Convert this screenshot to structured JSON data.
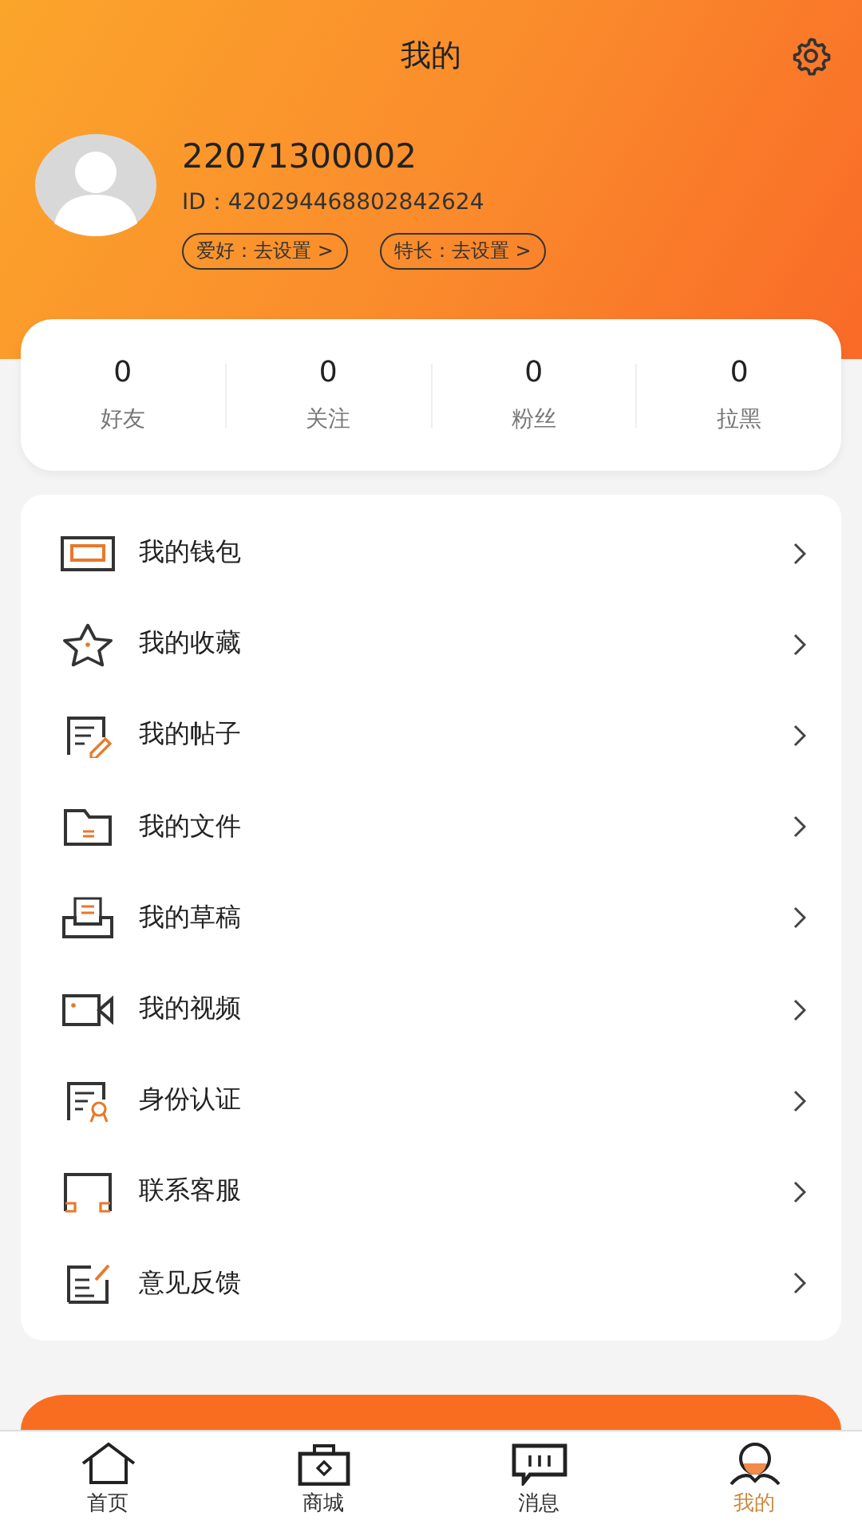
{
  "header": {
    "title": "我的"
  },
  "profile": {
    "name": "22071300002",
    "id": "ID：420294468802842624",
    "tags": [
      "爱好：去设置 >",
      "特长：去设置 >"
    ]
  },
  "stats": [
    {
      "value": "0",
      "label": "好友"
    },
    {
      "value": "0",
      "label": "关注"
    },
    {
      "value": "0",
      "label": "粉丝"
    },
    {
      "value": "0",
      "label": "拉黑"
    }
  ],
  "menu": [
    {
      "label": "我的钱包"
    },
    {
      "label": "我的收藏"
    },
    {
      "label": "我的帖子"
    },
    {
      "label": "我的文件"
    },
    {
      "label": "我的草稿"
    },
    {
      "label": "我的视频"
    },
    {
      "label": "身份认证"
    },
    {
      "label": "联系客服"
    },
    {
      "label": "意见反馈"
    }
  ],
  "tab_bar": [
    {
      "label": "首页",
      "selected": false
    },
    {
      "label": "商城",
      "selected": false
    },
    {
      "label": "消息",
      "selected": false
    },
    {
      "label": "我的",
      "selected": true
    }
  ]
}
